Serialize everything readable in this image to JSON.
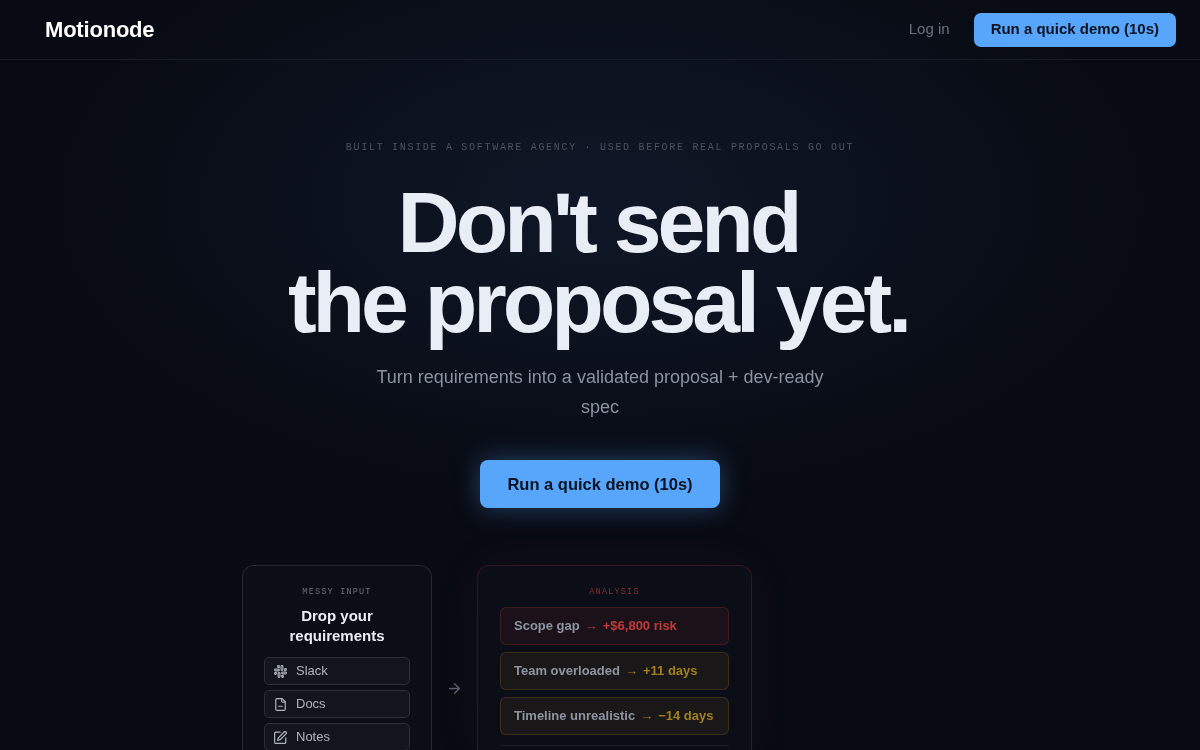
{
  "navbar": {
    "logo": "Motionode",
    "login_link": "Log in",
    "cta_button": "Run a quick demo (10s)"
  },
  "hero": {
    "eyebrow": "BUILT INSIDE A SOFTWARE AGENCY · USED BEFORE REAL PROPOSALS GO OUT",
    "headline": [
      "Don't send",
      "the proposal yet."
    ],
    "subtitle": "Turn requirements into a validated proposal + dev-ready spec",
    "cta_button": "Run a quick demo (10s)"
  },
  "input_card": {
    "label": "MESSY INPUT",
    "title": "Drop your requirements",
    "sources": [
      {
        "kind": "chat",
        "label": "Slack"
      },
      {
        "kind": "doc",
        "label": "Docs"
      },
      {
        "kind": "note",
        "label": "Notes"
      }
    ]
  },
  "analysis_card": {
    "label": "ANALYSIS",
    "findings": [
      {
        "issue": "Scope gap",
        "arrow": "→",
        "impact": "+$6,800 risk",
        "color": "#c13a3a"
      },
      {
        "issue": "Team overloaded",
        "arrow": "→",
        "impact": "+11 days",
        "color": "#a37f1d"
      },
      {
        "issue": "Timeline unrealistic",
        "arrow": "→",
        "impact": "−14 days",
        "color": "#a37f1d"
      }
    ]
  }
}
